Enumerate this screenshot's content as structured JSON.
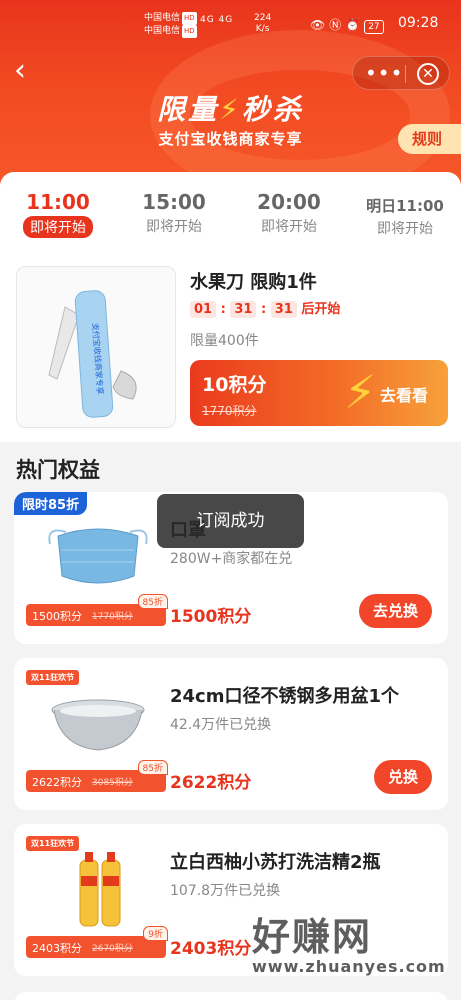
{
  "status_bar": {
    "carrier1": "中国电信",
    "carrier2": "中国电信",
    "hd": "HD",
    "signal": "4G 4G",
    "speed_value": "224",
    "speed_unit": "K/s",
    "battery": "27",
    "time": "09:28"
  },
  "header": {
    "title_part1": "限量",
    "title_part2": "秒杀",
    "subtitle": "支付宝收钱商家专享",
    "rules_label": "规则",
    "more_label": "•••",
    "close_label": "✕"
  },
  "tabs": [
    {
      "time": "11:00",
      "status": "即将开始"
    },
    {
      "time": "15:00",
      "status": "即将开始"
    },
    {
      "time": "20:00",
      "status": "即将开始"
    },
    {
      "time": "明日11:00",
      "status": "即将开始"
    }
  ],
  "featured": {
    "name": "水果刀 限购1件",
    "countdown_h": "01",
    "countdown_m": "31",
    "countdown_s": "31",
    "countdown_suffix": "后开始",
    "limit": "限量400件",
    "points": "10积分",
    "orig_points": "1770积分",
    "cta": "去看看",
    "product_label": "支付宝收钱商家专享"
  },
  "hot": {
    "title": "热门权益",
    "items": [
      {
        "tag": "限时85折",
        "name": "口罩",
        "sold": "280W+商家都在兑",
        "price": "1500积分",
        "ptag_price": "1500积分",
        "ptag_orig": "1770积分",
        "ptag_discount": "85折",
        "button": "去兑换"
      },
      {
        "tag": "双11狂欢节",
        "name": "24cm口径不锈钢多用盆1个",
        "sold": "42.4万件已兑换",
        "price": "2622积分",
        "ptag_price": "2622积分",
        "ptag_orig": "3085积分",
        "ptag_discount": "85折",
        "button": "兑换"
      },
      {
        "tag": "双11狂欢节",
        "name": "立白西柚小苏打洗洁精2瓶",
        "sold": "107.8万件已兑换",
        "price": "2403积分",
        "ptag_price": "2403积分",
        "ptag_orig": "2670积分",
        "ptag_discount": "9折",
        "button": ""
      }
    ]
  },
  "toast": "订阅成功",
  "watermark": {
    "text": "好赚网",
    "url": "www.zhuanyes.com"
  },
  "colors": {
    "accent": "#e8341c",
    "blue_tag": "#1d63d8",
    "gold": "#ffd23a"
  }
}
